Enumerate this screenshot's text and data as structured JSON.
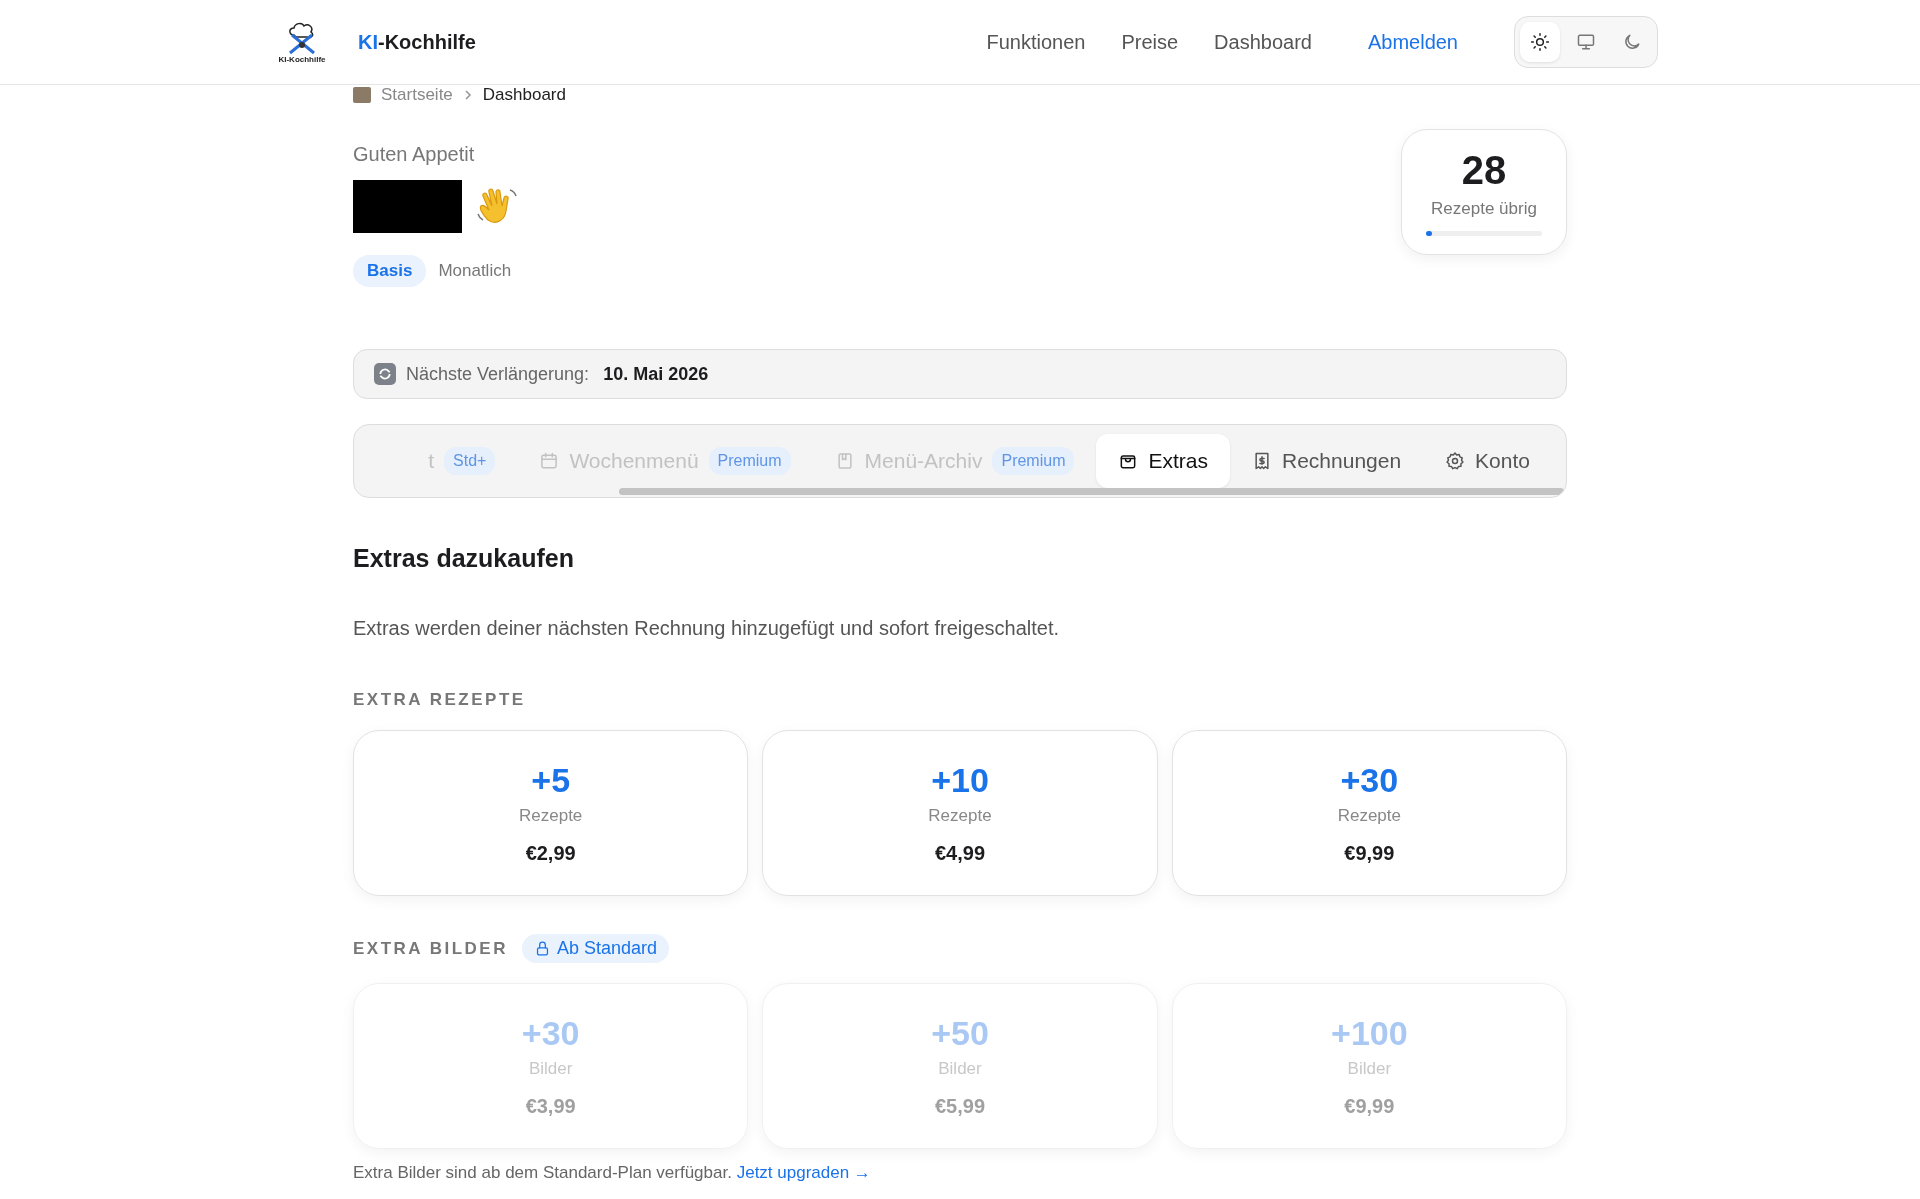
{
  "header": {
    "logo_caption": "KI-Kochhilfe",
    "brand_accent": "KI",
    "brand_rest": "-Kochhilfe",
    "nav": [
      {
        "label": "Funktionen",
        "kind": "link"
      },
      {
        "label": "Preise",
        "kind": "link"
      },
      {
        "label": "Dashboard",
        "kind": "link"
      },
      {
        "label": "Abmelden",
        "kind": "accent"
      }
    ],
    "theme": [
      {
        "kind": "sun",
        "selected": true
      },
      {
        "kind": "monitor",
        "selected": false
      },
      {
        "kind": "moon",
        "selected": false
      }
    ]
  },
  "breadcrumb": [
    "Startseite",
    "Dashboard"
  ],
  "greeting": {
    "label": "Guten Appetit",
    "plan_badge": "Basis",
    "billing": "Monatlich"
  },
  "quota": {
    "value": "28",
    "label": "Rezepte übrig",
    "level": 0.04
  },
  "renewal": {
    "label": "Nächste Verlängerung:",
    "date": "10. Mai 2026"
  },
  "tabs": [
    {
      "label": "t",
      "badge": "Std+",
      "kind": "none",
      "disabled": true,
      "selected": false
    },
    {
      "label": "Wochenmenü",
      "badge": "Premium",
      "kind": "calendar",
      "disabled": true,
      "selected": false
    },
    {
      "label": "Menü-Archiv",
      "badge": "Premium",
      "kind": "bookmark",
      "disabled": true,
      "selected": false
    },
    {
      "label": "Extras",
      "kind": "bag",
      "disabled": false,
      "selected": true
    },
    {
      "label": "Rechnungen",
      "kind": "receipt",
      "disabled": false,
      "selected": false
    },
    {
      "label": "Konto",
      "kind": "gear",
      "disabled": false,
      "selected": false
    }
  ],
  "section": {
    "title": "Extras dazukaufen",
    "description": "Extras werden deiner nächsten Rechnung hinzugefügt und sofort freigeschaltet."
  },
  "groups": [
    {
      "title": "EXTRA REZEPTE",
      "locked": false,
      "items": [
        {
          "amount": "+5",
          "unit": "Rezepte",
          "price": "€2,99"
        },
        {
          "amount": "+10",
          "unit": "Rezepte",
          "price": "€4,99"
        },
        {
          "amount": "+30",
          "unit": "Rezepte",
          "price": "€9,99"
        }
      ]
    },
    {
      "title": "EXTRA BILDER",
      "badge": "Ab Standard",
      "locked": true,
      "items": [
        {
          "amount": "+30",
          "unit": "Bilder",
          "price": "€3,99"
        },
        {
          "amount": "+50",
          "unit": "Bilder",
          "price": "€5,99"
        },
        {
          "amount": "+100",
          "unit": "Bilder",
          "price": "€9,99"
        }
      ]
    }
  ],
  "footnote": {
    "text": "Extra Bilder sind ab dem Standard-Plan verfügbar.",
    "link": "Jetzt upgraden →"
  }
}
